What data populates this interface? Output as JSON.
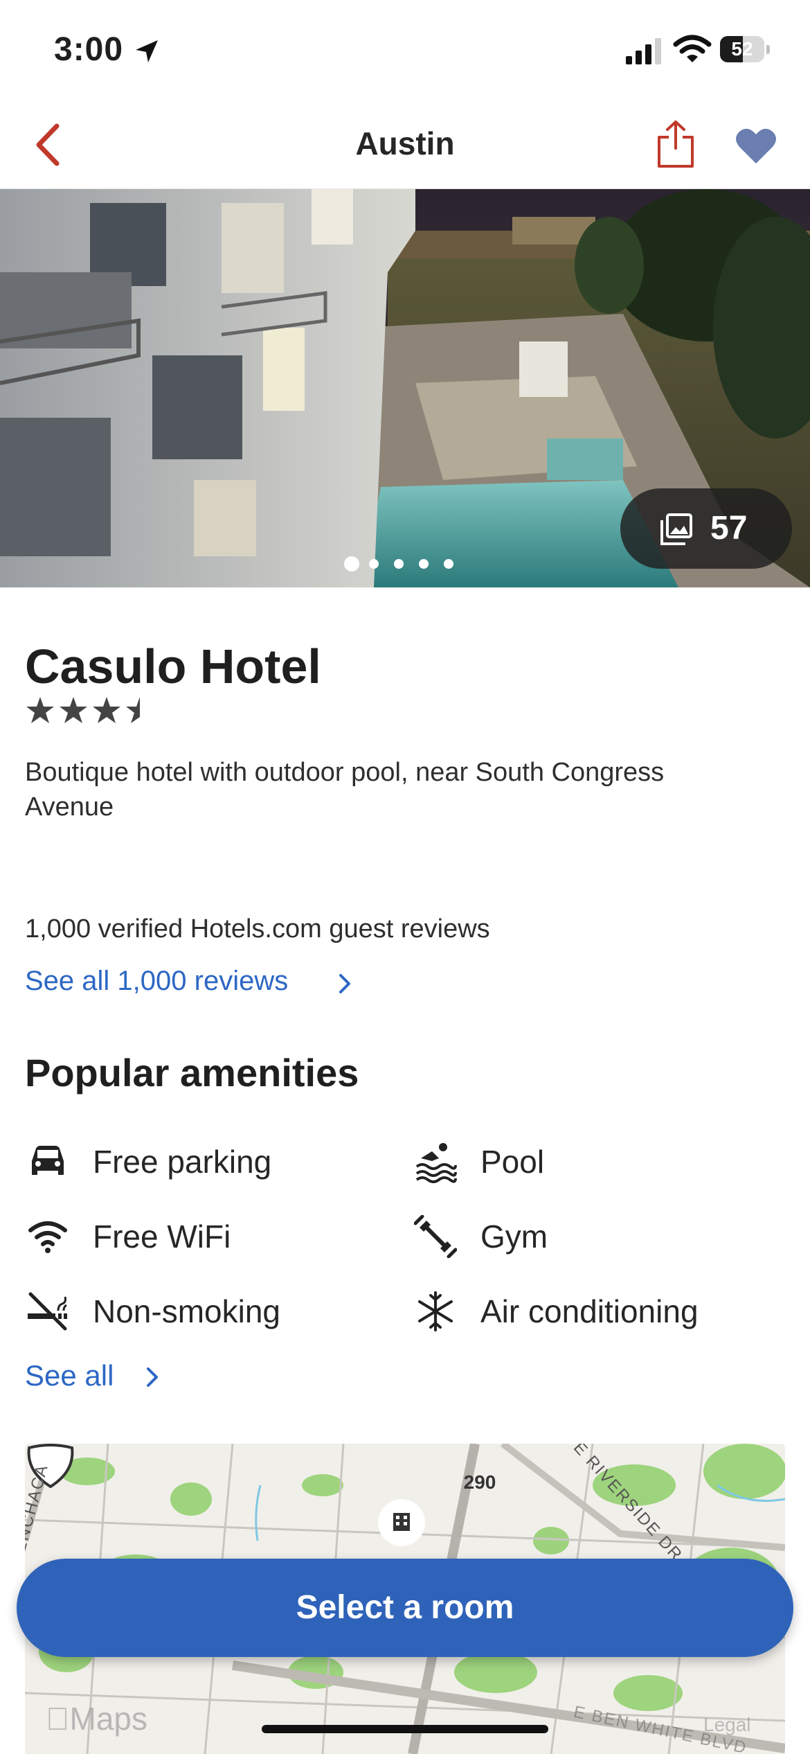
{
  "status_bar": {
    "time": "3:00",
    "battery": "52",
    "battery_level": 0.52
  },
  "nav": {
    "title": "Austin",
    "back_icon": "chevron-left-icon",
    "share_icon": "share-icon",
    "favorite_icon": "heart-icon"
  },
  "gallery": {
    "photo_count": "57",
    "pages": 5,
    "active_page": 0
  },
  "hotel": {
    "name": "Casulo Hotel",
    "star_rating": 3.5,
    "tagline": "Boutique hotel with outdoor pool, near South Congress Avenue",
    "reviews_count_text": "1,000 verified Hotels.com guest reviews",
    "reviews_link": "See all 1,000 reviews"
  },
  "amenities": {
    "title": "Popular amenities",
    "items": [
      {
        "label": "Free parking",
        "icon": "car-icon"
      },
      {
        "label": "Pool",
        "icon": "pool-icon"
      },
      {
        "label": "Free WiFi",
        "icon": "wifi-icon"
      },
      {
        "label": "Gym",
        "icon": "dumbbell-icon"
      },
      {
        "label": "Non-smoking",
        "icon": "no-smoking-icon"
      },
      {
        "label": "Air conditioning",
        "icon": "snowflake-icon"
      }
    ],
    "see_all": "See all"
  },
  "map": {
    "highway": "290",
    "road_labels": [
      "E RIVERSIDE DR",
      "MENCHACA",
      "E BEN WHITE BLVD"
    ],
    "maps_brand": "Maps",
    "legal": "Legal"
  },
  "cta": {
    "label": "Select a room"
  },
  "colors": {
    "accent": "#2f63b9",
    "link": "#2d67c4",
    "back": "#c0392b",
    "heart": "#6a7fb0"
  }
}
